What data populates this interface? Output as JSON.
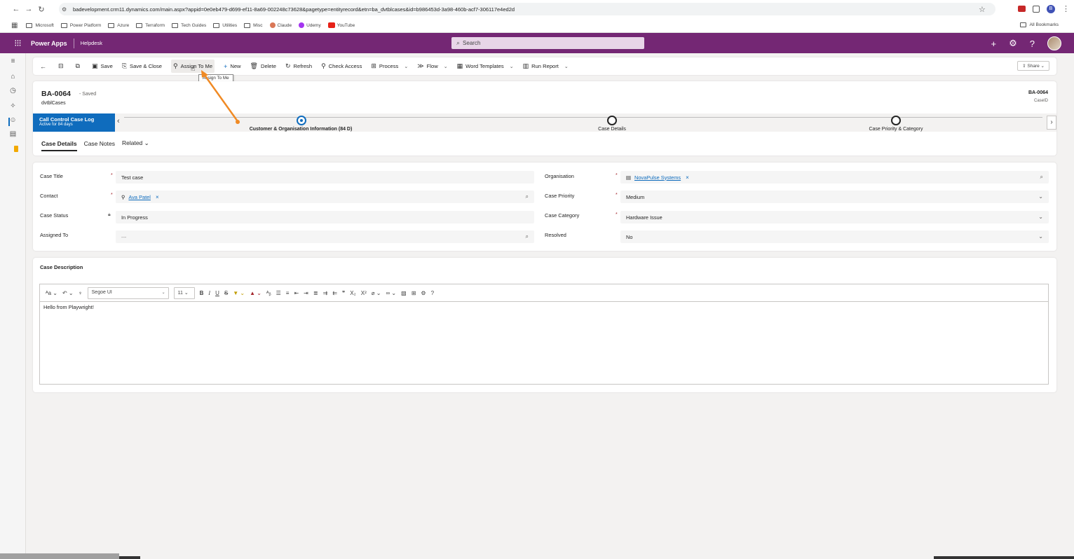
{
  "browser": {
    "url": "badevelopment.crm11.dynamics.com/main.aspx?appid=0e0eb479-d699-ef11-8a69-002248c73628&pagetype=entityrecord&etn=ba_dvtblcases&id=b986453d-3a98-460b-acf7-306117e4ed2d",
    "bookmarks": [
      "Microsoft",
      "Power Platform",
      "Azure",
      "Terraform",
      "Tech Guides",
      "Utilities",
      "Misc",
      "Claude",
      "Udemy",
      "YouTube"
    ],
    "all_bookmarks": "All Bookmarks",
    "profile": "B"
  },
  "header": {
    "app_name": "Power Apps",
    "area": "Helpdesk",
    "search_placeholder": "Search"
  },
  "commands": {
    "save": "Save",
    "save_close": "Save & Close",
    "assign_to_me": "Assign To Me",
    "new": "New",
    "delete": "Delete",
    "refresh": "Refresh",
    "check_access": "Check Access",
    "process": "Process",
    "flow": "Flow",
    "word_templates": "Word Templates",
    "run_report": "Run Report",
    "share": "Share",
    "tooltip": "Assign To Me"
  },
  "record": {
    "title": "BA-0064",
    "saved": "- Saved",
    "entity": "dvtblCases",
    "id_value": "BA-0064",
    "id_label": "CaseID"
  },
  "bpf": {
    "process_name": "Call Control Case Log",
    "active_for": "Active for 84 days",
    "stages": [
      {
        "label": "Customer & Organisation Information  (84 D)",
        "active": true
      },
      {
        "label": "Case Details",
        "active": false
      },
      {
        "label": "Case Priority & Category",
        "active": false
      }
    ]
  },
  "tabs": [
    "Case Details",
    "Case Notes",
    "Related"
  ],
  "form": {
    "case_title_label": "Case Title",
    "case_title": "Test case",
    "contact_label": "Contact",
    "contact": "Ava Patel",
    "case_status_label": "Case Status",
    "case_status": "In Progress",
    "assigned_to_label": "Assigned To",
    "assigned_to": "---",
    "organisation_label": "Organisation",
    "organisation": "NovaPulse Systems",
    "case_priority_label": "Case Priority",
    "case_priority": "Medium",
    "case_category_label": "Case Category",
    "case_category": "Hardware Issue",
    "resolved_label": "Resolved",
    "resolved": "No"
  },
  "description": {
    "label": "Case Description",
    "font": "Segoe UI",
    "size": "11",
    "body": "Hello from Playwright!"
  },
  "colors": {
    "header": "#742774",
    "accent": "#0f6cbd",
    "annotation": "#f08a24"
  }
}
